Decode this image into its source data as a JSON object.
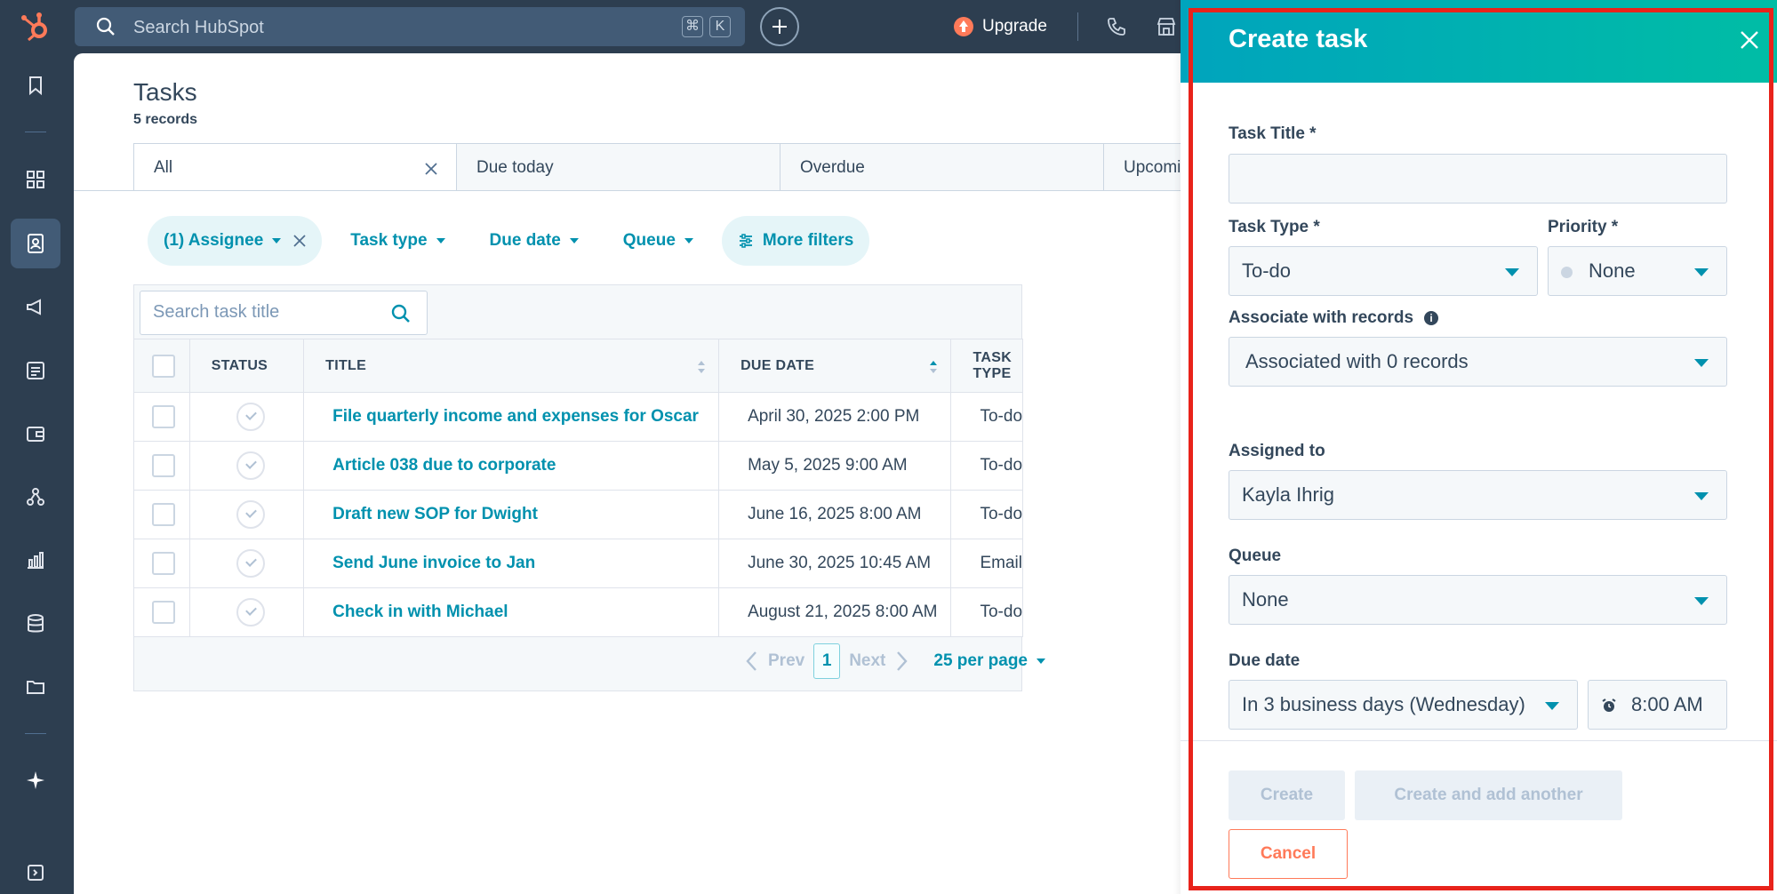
{
  "topbar": {
    "search_placeholder": "Search HubSpot",
    "shortcut_cmd": "⌘",
    "shortcut_key": "K",
    "upgrade_label": "Upgrade"
  },
  "page": {
    "title": "Tasks",
    "record_count": "5 records"
  },
  "tabs": [
    {
      "label": "All"
    },
    {
      "label": "Due today"
    },
    {
      "label": "Overdue"
    },
    {
      "label": "Upcoming"
    }
  ],
  "filters": {
    "assignee": "(1) Assignee",
    "task_type": "Task type",
    "due_date": "Due date",
    "queue": "Queue",
    "more": "More filters"
  },
  "table": {
    "search_placeholder": "Search task title",
    "columns": {
      "status": "STATUS",
      "title": "TITLE",
      "due_date": "DUE DATE",
      "task_type": "TASK TYPE"
    },
    "rows": [
      {
        "title": "File quarterly income and expenses for Oscar",
        "due": "April 30, 2025 2:00 PM",
        "type": "To-do"
      },
      {
        "title": "Article 038 due to corporate",
        "due": "May 5, 2025 9:00 AM",
        "type": "To-do"
      },
      {
        "title": "Draft new SOP for Dwight",
        "due": "June 16, 2025 8:00 AM",
        "type": "To-do"
      },
      {
        "title": "Send June invoice to Jan",
        "due": "June 30, 2025 10:45 AM",
        "type": "Email"
      },
      {
        "title": "Check in with Michael",
        "due": "August 21, 2025 8:00 AM",
        "type": "To-do"
      }
    ]
  },
  "pagination": {
    "prev": "Prev",
    "page": "1",
    "next": "Next",
    "per_page": "25 per page"
  },
  "panel": {
    "title": "Create task",
    "task_title_label": "Task Title *",
    "task_title_value": "",
    "task_type_label": "Task Type *",
    "task_type_value": "To-do",
    "priority_label": "Priority *",
    "priority_value": "None",
    "associate_label": "Associate with records",
    "associate_value": "Associated with 0 records",
    "assigned_label": "Assigned to",
    "assigned_value": "Kayla Ihrig",
    "queue_label": "Queue",
    "queue_value": "None",
    "due_label": "Due date",
    "due_value": "In 3 business days (Wednesday)",
    "time_value": "8:00 AM",
    "create_label": "Create",
    "create_another_label": "Create and add another",
    "cancel_label": "Cancel"
  },
  "colors": {
    "accent": "#0091ae",
    "header_gradient_start": "#00a4bd",
    "header_gradient_end": "#00bda5",
    "cancel": "#ff7a59",
    "highlight": "#e8231b",
    "nav_bg": "#2d3e50"
  }
}
